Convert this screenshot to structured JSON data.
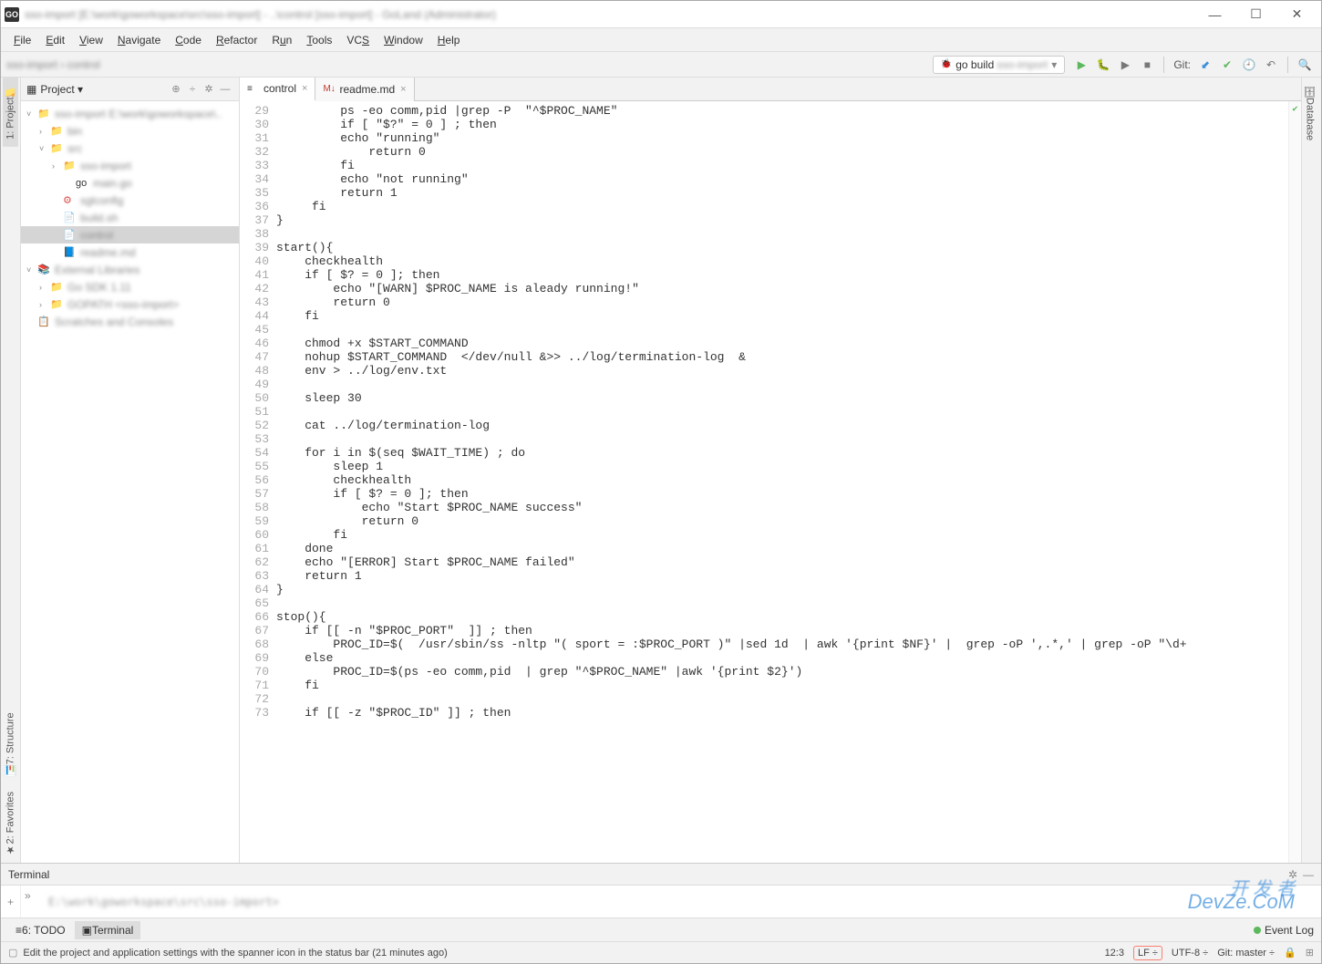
{
  "window": {
    "app_icon_text": "GO",
    "title_blur": "sso-import [E:\\work\\goworkspace\\src\\sso-import] - ..\\control [sso-import] - GoLand (Administrator)"
  },
  "win_controls": {
    "min": "—",
    "max": "☐",
    "close": "✕"
  },
  "menubar": [
    "File",
    "Edit",
    "View",
    "Navigate",
    "Code",
    "Refactor",
    "Run",
    "Tools",
    "VCS",
    "Window",
    "Help"
  ],
  "navbar": {
    "crumbs_blur": "sso-import › control",
    "run_config_label": "go build",
    "run_config_blur": "sso-import",
    "git_label": "Git:"
  },
  "left_tabs": {
    "project": "1: Project",
    "structure": "7: Structure",
    "favorites": "2: Favorites"
  },
  "right_tabs": {
    "database": "Database"
  },
  "project_panel": {
    "title": "Project",
    "tree": [
      {
        "indent": 0,
        "arrow": "˅",
        "icon": "📁",
        "label": "sso-import E:\\work\\goworkspace\\..",
        "blur": true
      },
      {
        "indent": 1,
        "arrow": "›",
        "icon": "📁",
        "label": "bin",
        "blur": true
      },
      {
        "indent": 1,
        "arrow": "˅",
        "icon": "📁",
        "label": "src",
        "blur": true
      },
      {
        "indent": 2,
        "arrow": "›",
        "icon": "📁",
        "label": "sso-import",
        "blur": true
      },
      {
        "indent": 3,
        "arrow": "",
        "icon": "go",
        "label": "main.go",
        "blur": true
      },
      {
        "indent": 2,
        "arrow": "",
        "icon": "⚙",
        "label": "sglconfig",
        "blur": true,
        "red": true
      },
      {
        "indent": 2,
        "arrow": "",
        "icon": "📄",
        "label": "build.sh",
        "blur": true
      },
      {
        "indent": 2,
        "arrow": "",
        "icon": "📄",
        "label": "control",
        "blur": true,
        "selected": true
      },
      {
        "indent": 2,
        "arrow": "",
        "icon": "📘",
        "label": "readme.md",
        "blur": true
      },
      {
        "indent": 0,
        "arrow": "˅",
        "icon": "📚",
        "label": "External Libraries",
        "blur": true
      },
      {
        "indent": 1,
        "arrow": "›",
        "icon": "📁",
        "label": "Go SDK 1.11",
        "blur": true
      },
      {
        "indent": 1,
        "arrow": "›",
        "icon": "📁",
        "label": "GOPATH <sso-import>",
        "blur": true
      },
      {
        "indent": 0,
        "arrow": "",
        "icon": "📋",
        "label": "Scratches and Consoles",
        "blur": true
      }
    ]
  },
  "editor": {
    "tabs": [
      {
        "icon": "≡",
        "label": "control",
        "active": true
      },
      {
        "icon": "M↓",
        "label": "readme.md",
        "active": false
      }
    ],
    "first_line": 29,
    "lines": [
      "         ps -eo comm,pid |grep -P  \"^$PROC_NAME\"",
      "         if [ \"$?\" = 0 ] ; then",
      "         echo \"running\"",
      "             return 0",
      "         fi",
      "         echo \"not running\"",
      "         return 1",
      "     fi",
      "}",
      "",
      "start(){",
      "    checkhealth",
      "    if [ $? = 0 ]; then",
      "        echo \"[WARN] $PROC_NAME is aleady running!\"",
      "        return 0",
      "    fi",
      "",
      "    chmod +x $START_COMMAND",
      "    nohup $START_COMMAND  </dev/null &>> ../log/termination-log  &",
      "    env > ../log/env.txt",
      "",
      "    sleep 30",
      "",
      "    cat ../log/termination-log",
      "",
      "    for i in $(seq $WAIT_TIME) ; do",
      "        sleep 1",
      "        checkhealth",
      "        if [ $? = 0 ]; then",
      "            echo \"Start $PROC_NAME success\"",
      "            return 0",
      "        fi",
      "    done",
      "    echo \"[ERROR] Start $PROC_NAME failed\"",
      "    return 1",
      "}",
      "",
      "stop(){",
      "    if [[ -n \"$PROC_PORT\"  ]] ; then",
      "        PROC_ID=$(  /usr/sbin/ss -nltp \"( sport = :$PROC_PORT )\" |sed 1d  | awk '{print $NF}' |  grep -oP ',.*,' | grep -oP \"\\d+",
      "    else",
      "        PROC_ID=$(ps -eo comm,pid  | grep \"^$PROC_NAME\" |awk '{print $2}')",
      "    fi",
      "",
      "    if [[ -z \"$PROC_ID\" ]] ; then"
    ]
  },
  "terminal": {
    "title": "Terminal",
    "prompt_blur": "E:\\work\\goworkspace\\src\\sso-import>"
  },
  "bottom_bar": {
    "todo": "6: TODO",
    "terminal": "Terminal",
    "event_log": "Event Log"
  },
  "status_bar": {
    "message": "Edit the project and application settings with the spanner icon in the status bar (21 minutes ago)",
    "position": "12:3",
    "line_sep": "LF",
    "encoding": "UTF-8",
    "git": "Git: master",
    "lock": "🔒"
  },
  "watermark": {
    "line1": "开 发 者",
    "line2": "DevZe.CoM"
  }
}
